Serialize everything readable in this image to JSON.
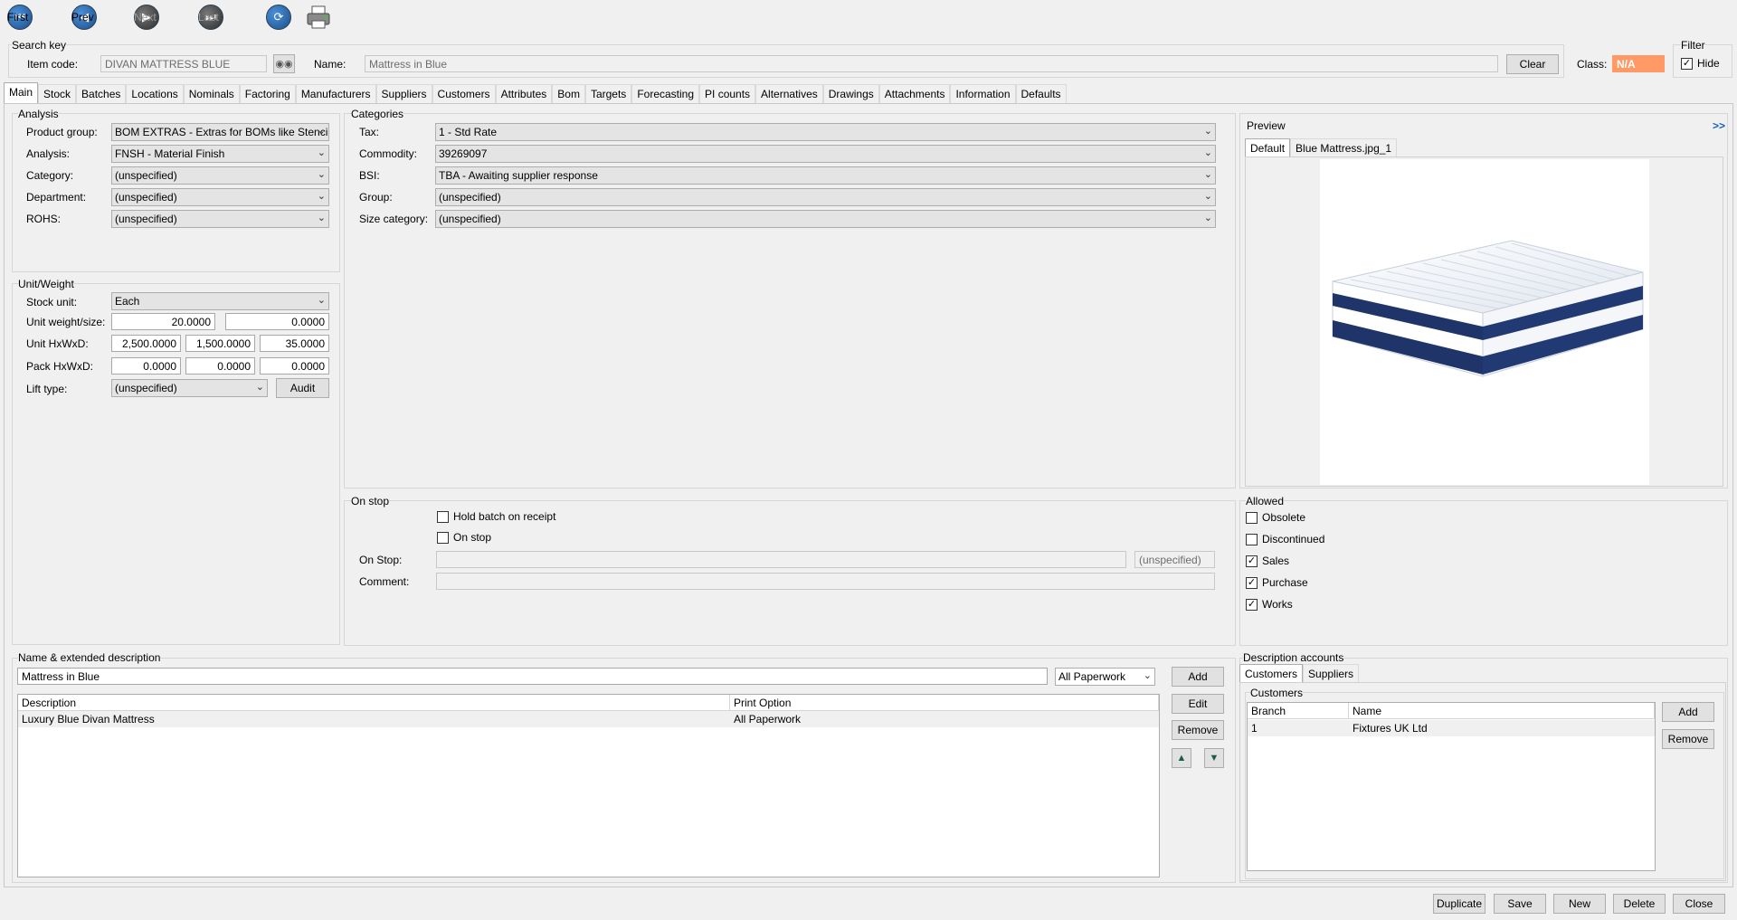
{
  "nav": {
    "first": "First",
    "prev": "Prev",
    "next": "Next",
    "last": "Last"
  },
  "search_key": {
    "title": "Search key",
    "item_code_label": "Item code:",
    "item_code_value": "DIVAN MATTRESS BLUE",
    "name_label": "Name:",
    "name_value": "Mattress in Blue",
    "clear_label": "Clear",
    "class_label": "Class:",
    "class_value": "N/A"
  },
  "filter": {
    "title": "Filter",
    "hide_label": "Hide",
    "hide_checked": true
  },
  "tabs": [
    "Main",
    "Stock",
    "Batches",
    "Locations",
    "Nominals",
    "Factoring",
    "Manufacturers",
    "Suppliers",
    "Customers",
    "Attributes",
    "Bom",
    "Targets",
    "Forecasting",
    "PI counts",
    "Alternatives",
    "Drawings",
    "Attachments",
    "Information",
    "Defaults"
  ],
  "analysis": {
    "title": "Analysis",
    "rows": [
      {
        "label": "Product group:",
        "value": "BOM EXTRAS - Extras for BOMs like Stencils"
      },
      {
        "label": "Analysis:",
        "value": "FNSH - Material Finish"
      },
      {
        "label": "Category:",
        "value": "(unspecified)"
      },
      {
        "label": "Department:",
        "value": "(unspecified)"
      },
      {
        "label": "ROHS:",
        "value": "(unspecified)"
      }
    ]
  },
  "categories": {
    "title": "Categories",
    "rows": [
      {
        "label": "Tax:",
        "value": "1 - Std Rate"
      },
      {
        "label": "Commodity:",
        "value": "39269097"
      },
      {
        "label": "BSI:",
        "value": "TBA - Awaiting supplier response"
      },
      {
        "label": "Group:",
        "value": "(unspecified)"
      },
      {
        "label": "Size category:",
        "value": "(unspecified)"
      }
    ]
  },
  "unit_weight": {
    "title": "Unit/Weight",
    "stock_unit_label": "Stock unit:",
    "stock_unit_value": "Each",
    "weight_label": "Unit weight/size:",
    "weight_values": [
      "20.0000",
      "0.0000"
    ],
    "unit_label": "Unit HxWxD:",
    "unit_values": [
      "2,500.0000",
      "1,500.0000",
      "35.0000"
    ],
    "pack_label": "Pack HxWxD:",
    "pack_values": [
      "0.0000",
      "0.0000",
      "0.0000"
    ],
    "lift_label": "Lift type:",
    "lift_value": "(unspecified)",
    "audit_label": "Audit"
  },
  "preview": {
    "title": "Preview",
    "expand": ">>",
    "tabs": [
      "Default",
      "Blue Mattress.jpg_1"
    ]
  },
  "on_stop": {
    "title": "On stop",
    "hold_batch_label": "Hold batch on receipt",
    "hold_batch_checked": false,
    "on_stop_check_label": "On stop",
    "on_stop_checked": false,
    "on_stop_label": "On Stop:",
    "on_stop_value": "",
    "on_stop_combo": "(unspecified)",
    "comment_label": "Comment:",
    "comment_value": ""
  },
  "allowed": {
    "title": "Allowed",
    "items": [
      {
        "label": "Obsolete",
        "checked": false
      },
      {
        "label": "Discontinued",
        "checked": false
      },
      {
        "label": "Sales",
        "checked": true
      },
      {
        "label": "Purchase",
        "checked": true
      },
      {
        "label": "Works",
        "checked": true
      }
    ]
  },
  "name_desc": {
    "title": "Name & extended description",
    "input_value": "Mattress in Blue",
    "paperwork_value": "All Paperwork",
    "add_label": "Add",
    "edit_label": "Edit",
    "remove_label": "Remove",
    "columns": [
      "Description",
      "Print Option"
    ],
    "rows": [
      {
        "description": "Luxury Blue Divan Mattress",
        "print_option": "All Paperwork"
      }
    ]
  },
  "desc_accounts": {
    "title": "Description accounts",
    "tabs": [
      "Customers",
      "Suppliers"
    ],
    "group_title": "Customers",
    "columns": [
      "Branch",
      "Name"
    ],
    "rows": [
      {
        "branch": "1",
        "name": "Fixtures UK Ltd"
      }
    ],
    "add_label": "Add",
    "remove_label": "Remove"
  },
  "footer": {
    "duplicate": "Duplicate",
    "save": "Save",
    "new": "New",
    "delete": "Delete",
    "close": "Close"
  }
}
